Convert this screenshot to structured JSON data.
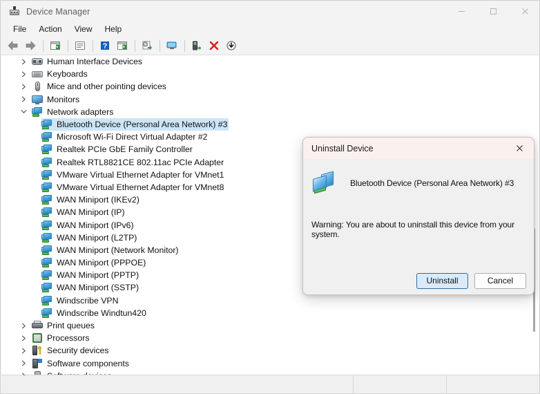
{
  "window": {
    "title": "Device Manager",
    "icon": "device-manager-icon",
    "controls": {
      "minimize": "—",
      "maximize": "□",
      "close": "✕"
    }
  },
  "menubar": {
    "items": [
      "File",
      "Action",
      "View",
      "Help"
    ]
  },
  "toolbar": {
    "buttons": [
      {
        "name": "back-button",
        "icon": "left-arrow-icon"
      },
      {
        "name": "forward-button",
        "icon": "right-arrow-icon"
      },
      {
        "name": "separator-1",
        "icon": "separator"
      },
      {
        "name": "show-hide-console-tree-button",
        "icon": "console-tree-icon"
      },
      {
        "name": "separator-2",
        "icon": "separator"
      },
      {
        "name": "properties-button",
        "icon": "properties-icon"
      },
      {
        "name": "separator-3",
        "icon": "separator"
      },
      {
        "name": "help-button",
        "icon": "question-mark-icon"
      },
      {
        "name": "show-hide-action-pane-button",
        "icon": "action-pane-icon"
      },
      {
        "name": "separator-4",
        "icon": "separator"
      },
      {
        "name": "update-driver-button",
        "icon": "update-driver-icon"
      },
      {
        "name": "separator-5",
        "icon": "separator"
      },
      {
        "name": "scan-for-hardware-changes-button",
        "icon": "scan-hardware-icon"
      },
      {
        "name": "separator-6",
        "icon": "separator"
      },
      {
        "name": "enable-device-button",
        "icon": "enable-device-icon"
      },
      {
        "name": "uninstall-device-button",
        "icon": "red-x-icon"
      },
      {
        "name": "disable-device-button",
        "icon": "down-arrow-circle-icon"
      }
    ]
  },
  "tree": {
    "nodes": [
      {
        "label": "Human Interface Devices",
        "depth": 0,
        "expander": "collapsed",
        "icon": "hid-icon",
        "selected": false
      },
      {
        "label": "Keyboards",
        "depth": 0,
        "expander": "collapsed",
        "icon": "keyboard-icon",
        "selected": false
      },
      {
        "label": "Mice and other pointing devices",
        "depth": 0,
        "expander": "collapsed",
        "icon": "mouse-icon",
        "selected": false
      },
      {
        "label": "Monitors",
        "depth": 0,
        "expander": "collapsed",
        "icon": "monitor-icon",
        "selected": false
      },
      {
        "label": "Network adapters",
        "depth": 0,
        "expander": "expanded",
        "icon": "network-adapter-icon",
        "selected": false
      },
      {
        "label": "Bluetooth Device (Personal Area Network) #3",
        "depth": 1,
        "expander": "none",
        "icon": "network-adapter-icon",
        "selected": true
      },
      {
        "label": "Microsoft Wi-Fi Direct Virtual Adapter #2",
        "depth": 1,
        "expander": "none",
        "icon": "network-adapter-icon",
        "selected": false
      },
      {
        "label": "Realtek PCIe GbE Family Controller",
        "depth": 1,
        "expander": "none",
        "icon": "network-adapter-icon",
        "selected": false
      },
      {
        "label": "Realtek RTL8821CE 802.11ac PCIe Adapter",
        "depth": 1,
        "expander": "none",
        "icon": "network-adapter-icon",
        "selected": false
      },
      {
        "label": "VMware Virtual Ethernet Adapter for VMnet1",
        "depth": 1,
        "expander": "none",
        "icon": "network-adapter-icon",
        "selected": false
      },
      {
        "label": "VMware Virtual Ethernet Adapter for VMnet8",
        "depth": 1,
        "expander": "none",
        "icon": "network-adapter-icon",
        "selected": false
      },
      {
        "label": "WAN Miniport (IKEv2)",
        "depth": 1,
        "expander": "none",
        "icon": "network-adapter-icon",
        "selected": false
      },
      {
        "label": "WAN Miniport (IP)",
        "depth": 1,
        "expander": "none",
        "icon": "network-adapter-icon",
        "selected": false
      },
      {
        "label": "WAN Miniport (IPv6)",
        "depth": 1,
        "expander": "none",
        "icon": "network-adapter-icon",
        "selected": false
      },
      {
        "label": "WAN Miniport (L2TP)",
        "depth": 1,
        "expander": "none",
        "icon": "network-adapter-icon",
        "selected": false
      },
      {
        "label": "WAN Miniport (Network Monitor)",
        "depth": 1,
        "expander": "none",
        "icon": "network-adapter-icon",
        "selected": false
      },
      {
        "label": "WAN Miniport (PPPOE)",
        "depth": 1,
        "expander": "none",
        "icon": "network-adapter-icon",
        "selected": false
      },
      {
        "label": "WAN Miniport (PPTP)",
        "depth": 1,
        "expander": "none",
        "icon": "network-adapter-icon",
        "selected": false
      },
      {
        "label": "WAN Miniport (SSTP)",
        "depth": 1,
        "expander": "none",
        "icon": "network-adapter-icon",
        "selected": false
      },
      {
        "label": "Windscribe VPN",
        "depth": 1,
        "expander": "none",
        "icon": "network-adapter-icon",
        "selected": false
      },
      {
        "label": "Windscribe Windtun420",
        "depth": 1,
        "expander": "none",
        "icon": "network-adapter-icon",
        "selected": false
      },
      {
        "label": "Print queues",
        "depth": 0,
        "expander": "collapsed",
        "icon": "printer-icon",
        "selected": false
      },
      {
        "label": "Processors",
        "depth": 0,
        "expander": "collapsed",
        "icon": "processor-icon",
        "selected": false
      },
      {
        "label": "Security devices",
        "depth": 0,
        "expander": "collapsed",
        "icon": "security-device-icon",
        "selected": false
      },
      {
        "label": "Software components",
        "depth": 0,
        "expander": "collapsed",
        "icon": "software-component-icon",
        "selected": false
      },
      {
        "label": "Software devices",
        "depth": 0,
        "expander": "collapsed",
        "icon": "software-device-icon",
        "selected": false
      }
    ]
  },
  "statusbar": {
    "text": ""
  },
  "dialog": {
    "title": "Uninstall Device",
    "close_label": "✕",
    "device_icon": "network-device-icon",
    "device_name": "Bluetooth Device (Personal Area Network) #3",
    "warning": "Warning: You are about to uninstall this device from your system.",
    "buttons": [
      {
        "label": "Uninstall",
        "name": "uninstall-button",
        "default": true
      },
      {
        "label": "Cancel",
        "name": "cancel-button",
        "default": false
      }
    ]
  },
  "colors": {
    "selection": "#cde5f7",
    "dialog_header": "#faf1ee",
    "default_button_fill": "#dbeaf8",
    "default_button_border": "#2e6ea3",
    "chrome": "#f3f3f3"
  }
}
